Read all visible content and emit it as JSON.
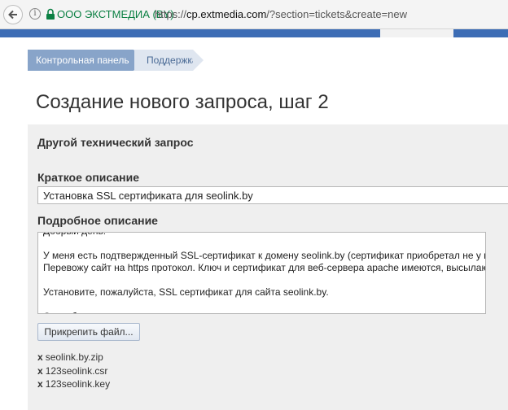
{
  "browser": {
    "site_name": "ООО ЭКСТМЕДИА (BY)",
    "url_scheme": "https://",
    "url_host": "cp.extmedia.com",
    "url_rest": "/?section=tickets&create=new"
  },
  "breadcrumb": [
    {
      "label": "Контрольная панель"
    },
    {
      "label": "Поддержка"
    }
  ],
  "page_title": "Создание нового запроса, шаг 2",
  "form": {
    "section_title": "Другой технический запрос",
    "short_label": "Краткое описание",
    "short_value": "Установка SSL сертификата для seolink.by",
    "long_label": "Подробное описание",
    "long_lines": [
      "Добрый день!",
      "",
      "У меня есть подтвержденный SSL-сертификат к домену seolink.by (сертификат приобретал не у вас).",
      "Перевожу сайт на https протокол. Ключ и сертификат для веб-сервера apache имеются, высылаю.",
      "",
      "Установите, пожалуйста, SSL сертификат для сайта seolink.by.",
      "",
      "Спасибо."
    ],
    "attach_label": "Прикрепить файл...",
    "remove_mark": "x",
    "files": [
      "seolink.by.zip",
      "123seolink.csr",
      "123seolink.key"
    ]
  },
  "colors": {
    "accent_blue": "#3d6db5",
    "crumb_active": "#88a4c9",
    "site_green": "#0b8043"
  }
}
